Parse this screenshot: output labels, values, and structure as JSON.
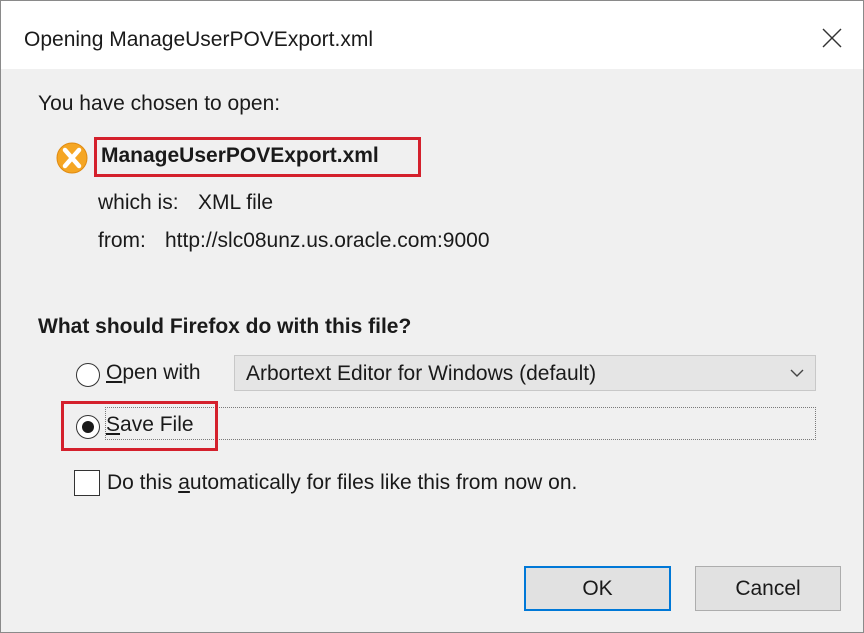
{
  "dialog": {
    "title": "Opening ManageUserPOVExport.xml",
    "close_icon": "close-icon"
  },
  "info": {
    "intro": "You have chosen to open:",
    "file_name": "ManageUserPOVExport.xml",
    "file_icon": "xml-file-icon",
    "which_is_label": "which is:",
    "which_is_value": "XML file",
    "from_label": "from:",
    "from_value": "http://slc08unz.us.oracle.com:9000"
  },
  "action": {
    "question": "What should Firefox do with this file?",
    "open_with": {
      "mnemonic": "O",
      "rest": "pen with",
      "selected": false,
      "app": "Arbortext Editor for Windows (default)"
    },
    "save_file": {
      "mnemonic": "S",
      "rest": "ave File",
      "selected": true
    },
    "auto": {
      "before": "Do this ",
      "mnemonic": "a",
      "after": "utomatically for files like this from now on.",
      "checked": false
    }
  },
  "buttons": {
    "ok": "OK",
    "cancel": "Cancel"
  },
  "colors": {
    "highlight": "#d4202c",
    "default_button_border": "#0078d7",
    "dialog_bg": "#f0f0f0",
    "icon_orange": "#f5a623"
  }
}
